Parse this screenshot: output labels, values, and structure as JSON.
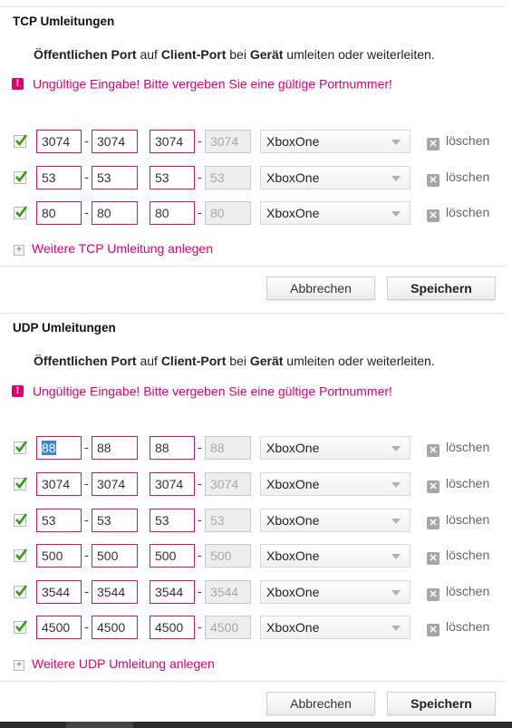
{
  "tcp": {
    "title": "TCP Umleitungen",
    "description": {
      "part1": "Öffentlichen Port",
      "part2": " auf ",
      "part3": "Client-Port",
      "part4": " bei ",
      "part5": "Gerät",
      "part6": " umleiten oder weiterleiten."
    },
    "error": "Ungültige Eingabe! Bitte vergeben Sie eine gültige Portnummer!",
    "rows": [
      {
        "p1": "3074",
        "p2": "3074",
        "p3": "3074",
        "p4": "3074",
        "device": "XboxOne",
        "delete": "löschen"
      },
      {
        "p1": "53",
        "p2": "53",
        "p3": "53",
        "p4": "53",
        "device": "XboxOne",
        "delete": "löschen"
      },
      {
        "p1": "80",
        "p2": "80",
        "p3": "80",
        "p4": "80",
        "device": "XboxOne",
        "delete": "löschen"
      }
    ],
    "add_label": "Weitere TCP Umleitung anlegen",
    "cancel_label": "Abbrechen",
    "save_label": "Speichern"
  },
  "udp": {
    "title": "UDP Umleitungen",
    "description": {
      "part1": "Öffentlichen Port",
      "part2": " auf ",
      "part3": "Client-Port",
      "part4": " bei ",
      "part5": "Gerät",
      "part6": " umleiten oder weiterleiten."
    },
    "error": "Ungültige Eingabe! Bitte vergeben Sie eine gültige Portnummer!",
    "rows": [
      {
        "p1": "88",
        "p2": "88",
        "p3": "88",
        "p4": "88",
        "device": "XboxOne",
        "delete": "löschen"
      },
      {
        "p1": "3074",
        "p2": "3074",
        "p3": "3074",
        "p4": "3074",
        "device": "XboxOne",
        "delete": "löschen"
      },
      {
        "p1": "53",
        "p2": "53",
        "p3": "53",
        "p4": "53",
        "device": "XboxOne",
        "delete": "löschen"
      },
      {
        "p1": "500",
        "p2": "500",
        "p3": "500",
        "p4": "500",
        "device": "XboxOne",
        "delete": "löschen"
      },
      {
        "p1": "3544",
        "p2": "3544",
        "p3": "3544",
        "p4": "3544",
        "device": "XboxOne",
        "delete": "löschen"
      },
      {
        "p1": "4500",
        "p2": "4500",
        "p3": "4500",
        "p4": "4500",
        "device": "XboxOne",
        "delete": "löschen"
      }
    ],
    "add_label": "Weitere UDP Umleitung anlegen",
    "cancel_label": "Abbrechen",
    "save_label": "Speichern"
  },
  "colors": {
    "accent": "#e2006e",
    "invalid_border": "#d4174f",
    "check": "#3a9a1c"
  }
}
